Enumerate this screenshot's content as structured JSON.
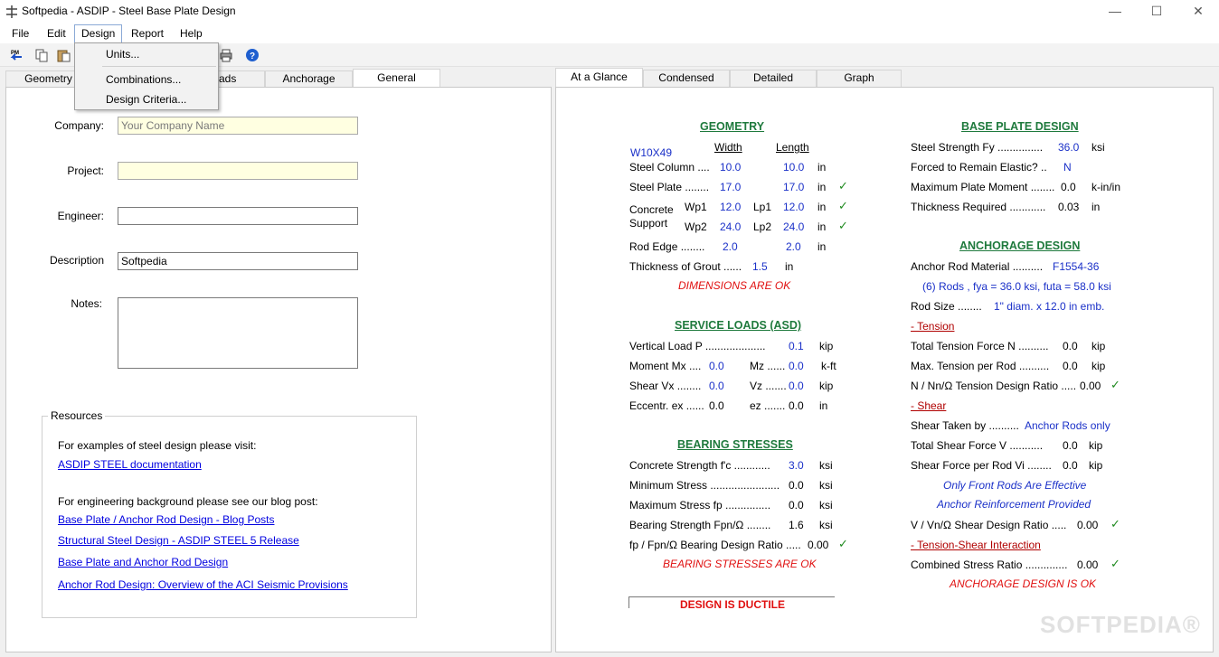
{
  "window": {
    "title": "Softpedia - ASDIP - Steel Base Plate Design",
    "minimize": "—",
    "maximize": "☐",
    "close": "✕"
  },
  "menu": [
    "File",
    "Edit",
    "Design",
    "Report",
    "Help"
  ],
  "design_menu": [
    "Units...",
    "Combinations...",
    "Design Criteria..."
  ],
  "toolbar_icons": [
    "pm-icon",
    "copy-icon",
    "paste-icon",
    "print-icon",
    "help-icon"
  ],
  "left_tabs": [
    "Geometry",
    "Loads",
    "Anchorage",
    "General"
  ],
  "left_tabs_visible": [
    "Geometry",
    "ads",
    "Anchorage",
    "General"
  ],
  "form": {
    "company_label": "Company:",
    "company_placeholder": "Your Company Name",
    "project_label": "Project:",
    "project_value": "",
    "engineer_label": "Engineer:",
    "engineer_value": "",
    "description_label": "Description",
    "description_value": "Softpedia",
    "notes_label": "Notes:",
    "notes_value": ""
  },
  "resources": {
    "legend": "Resources",
    "intro1": "For examples of steel design please visit:",
    "link1": "ASDIP STEEL documentation",
    "intro2": "For engineering background please see our blog post:",
    "links": [
      "Base Plate / Anchor Rod Design - Blog Posts",
      "Structural Steel Design - ASDIP STEEL 5 Release",
      "Base Plate and Anchor Rod Design",
      "Anchor Rod Design: Overview of the ACI Seismic Provisions"
    ]
  },
  "right_tabs": [
    "At a Glance",
    "Condensed",
    "Detailed",
    "Graph"
  ],
  "geometry": {
    "head": "GEOMETRY",
    "section": "W10X49",
    "width": "Width",
    "length": "Length",
    "steel_column": "Steel Column ....",
    "sc_w": "10.0",
    "sc_l": "10.0",
    "in": "in",
    "steel_plate": "Steel Plate ........",
    "sp_w": "17.0",
    "sp_l": "17.0",
    "concrete": "Concrete",
    "support": "Support",
    "wp1": "Wp1",
    "wp1v": "12.0",
    "lp1": "Lp1",
    "lp1v": "12.0",
    "wp2": "Wp2",
    "wp2v": "24.0",
    "lp2": "Lp2",
    "lp2v": "24.0",
    "rod_edge": "Rod Edge ........",
    "re_w": "2.0",
    "re_l": "2.0",
    "grout": "Thickness of Grout ......",
    "grout_v": "1.5",
    "ok": "DIMENSIONS ARE OK"
  },
  "service": {
    "head": "SERVICE LOADS (ASD)",
    "vertical": "Vertical Load  P ....................",
    "p": "0.1",
    "kip": "kip",
    "moment": "Moment  Mx ....",
    "mx": "0.0",
    "mz_l": "Mz ......",
    "mz": "0.0",
    "kft": "k-ft",
    "shear": "Shear  Vx ........",
    "vx": "0.0",
    "vz_l": "Vz .......",
    "vz": "0.0",
    "ecc": "Eccentr.  ex ......",
    "ex": "0.0",
    "ez_l": "ez .......",
    "ez": "0.0",
    "in": "in"
  },
  "bearing": {
    "head": "BEARING STRESSES",
    "fc": "Concrete Strength  f'c ............",
    "fc_v": "3.0",
    "ksi": "ksi",
    "min": "Minimum Stress .......................",
    "min_v": "0.0",
    "max": "Maximum Stress  fp ...............",
    "max_v": "0.0",
    "bs": "Bearing Strength  Fpn/Ω ........",
    "bs_v": "1.6",
    "ratio": "fp / Fpn/Ω Bearing Design Ratio .....",
    "ratio_v": "0.00",
    "ok": "BEARING STRESSES ARE OK",
    "ductile": "DESIGN IS DUCTILE"
  },
  "baseplate": {
    "head": "BASE PLATE DESIGN",
    "fy": "Steel Strength  Fy ...............",
    "fy_v": "36.0",
    "ksi": "ksi",
    "elastic": "Forced to Remain Elastic? ..",
    "elastic_v": "N",
    "mom": "Maximum Plate Moment ........",
    "mom_v": "0.0",
    "kin": "k-in/in",
    "thick": "Thickness Required ............",
    "thick_v": "0.03",
    "in": "in"
  },
  "anchorage": {
    "head": "ANCHORAGE DESIGN",
    "mat": "Anchor Rod Material ..........",
    "mat_v": "F1554-36",
    "rods": "(6)  Rods ,  fya = 36.0 ksi,   futa = 58.0 ksi",
    "size": "Rod Size ........",
    "size_v": "1\" diam. x 12.0 in emb.",
    "tension": "- Tension",
    "ttf": "Total Tension Force  N ..........",
    "ttf_v": "0.0",
    "kip": "kip",
    "mtr": "Max. Tension per Rod ..........",
    "mtr_v": "0.0",
    "tdr": "N / Nn/Ω Tension Design Ratio .....",
    "tdr_v": "0.00",
    "shear": "- Shear",
    "stb": "Shear Taken by ..........",
    "stb_v": "Anchor Rods only",
    "tsf": "Total Shear Force  V ...........",
    "tsf_v": "0.0",
    "sfr": "Shear Force per Rod  Vi ........",
    "sfr_v": "0.0",
    "front": "Only Front Rods Are Effective",
    "reinf": "Anchor Reinforcement Provided",
    "sdr": "V / Vn/Ω Shear Design Ratio .....",
    "sdr_v": "0.00",
    "tsi": "- Tension-Shear Interaction",
    "csr": "Combined Stress Ratio ..............",
    "csr_v": "0.00",
    "ok": "ANCHORAGE DESIGN IS OK"
  },
  "watermark": "SOFTPEDIA®",
  "colors": {
    "heading": "#1f7a3d",
    "value": "#1a30c8",
    "ok": "#e01010",
    "check": "#1f8a1f",
    "link": "#0000e0"
  }
}
